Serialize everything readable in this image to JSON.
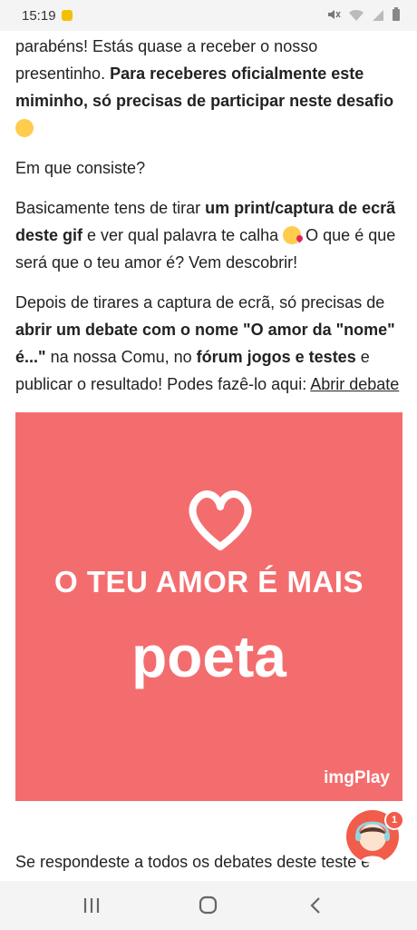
{
  "status_bar": {
    "time": "15:19"
  },
  "article": {
    "p1_a": "parabéns! Estás quase a receber o nosso presentinho. ",
    "p1_b": "Para receberes oficialmente este miminho, só precisas de participar neste desafio",
    "p2": "Em que consiste?",
    "p3_a": "Basicamente tens de tirar ",
    "p3_b": "um print/captura de ecrã deste gif",
    "p3_c": " e ver qual palavra te calha ",
    "p3_d": " O que é que será que o teu amor é? Vem descobrir!",
    "p4_a": "Depois de tirares a captura de ecrã, só precisas de ",
    "p4_b": "abrir um debate com o nome \"O amor da \"nome\" é...\"",
    "p4_c": " na nossa Comu, no ",
    "p4_d": "fórum jogos e testes",
    "p4_e": " e publicar o resultado! Podes fazê-lo aqui: ",
    "link": "Abrir debate"
  },
  "gif": {
    "headline": "O TEU AMOR É MAIS",
    "word": "poeta",
    "brand": "imgPlay",
    "bg_color": "#f46d6e"
  },
  "footer": {
    "text": "Se respondeste a todos os debates deste teste e"
  },
  "fab": {
    "badge": "1"
  }
}
